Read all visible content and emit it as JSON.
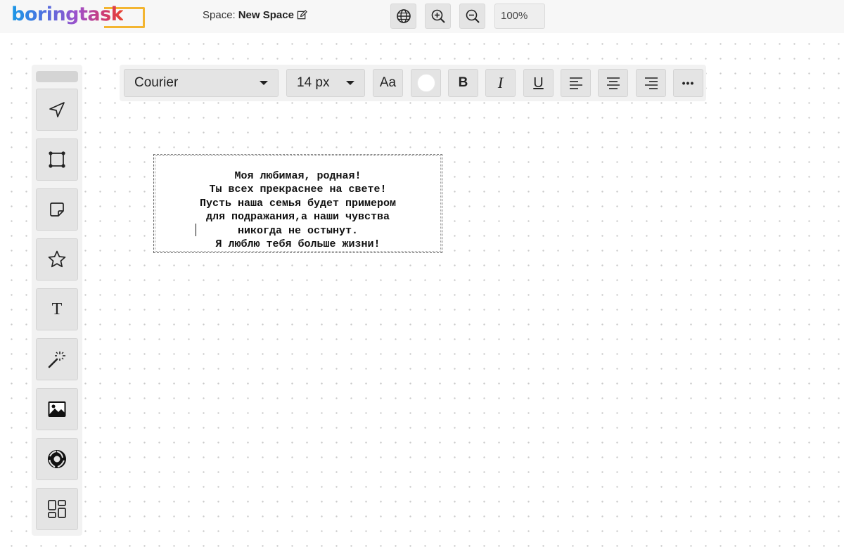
{
  "app": {
    "logo_text": "boringtask",
    "space_label": "Space:",
    "space_name": "New Space",
    "zoom_level": "100%"
  },
  "topbar_icons": [
    "globe-icon",
    "zoom-in-icon",
    "zoom-out-icon",
    "edit-icon"
  ],
  "sidebar": {
    "tools": [
      {
        "name": "select-tool",
        "icon": "cursor-arrow-icon"
      },
      {
        "name": "shape-tool",
        "icon": "square-nodes-icon"
      },
      {
        "name": "sticky-note-tool",
        "icon": "sticky-note-icon"
      },
      {
        "name": "star-tool",
        "icon": "star-icon"
      },
      {
        "name": "text-tool",
        "icon": "text-icon",
        "label": "T"
      },
      {
        "name": "magic-tool",
        "icon": "magic-wand-icon"
      },
      {
        "name": "image-tool",
        "icon": "image-icon"
      },
      {
        "name": "aperture-tool",
        "icon": "aperture-icon"
      },
      {
        "name": "templates-tool",
        "icon": "grid-layout-icon"
      }
    ]
  },
  "format_toolbar": {
    "font_family": "Courier",
    "font_size": "14 px",
    "case_label": "Aa",
    "color": "#ffffff",
    "bold_label": "B",
    "italic_label": "I",
    "underline_label": "U",
    "more_label": "•••"
  },
  "text_element": {
    "content": "Моя любимая, родная!\nТы всех прекраснее на свете!\nПусть наша семья будет примером\nдля подражания,а наши чувства\nникогда не остынут.\nЯ люблю тебя больше жизни!"
  }
}
